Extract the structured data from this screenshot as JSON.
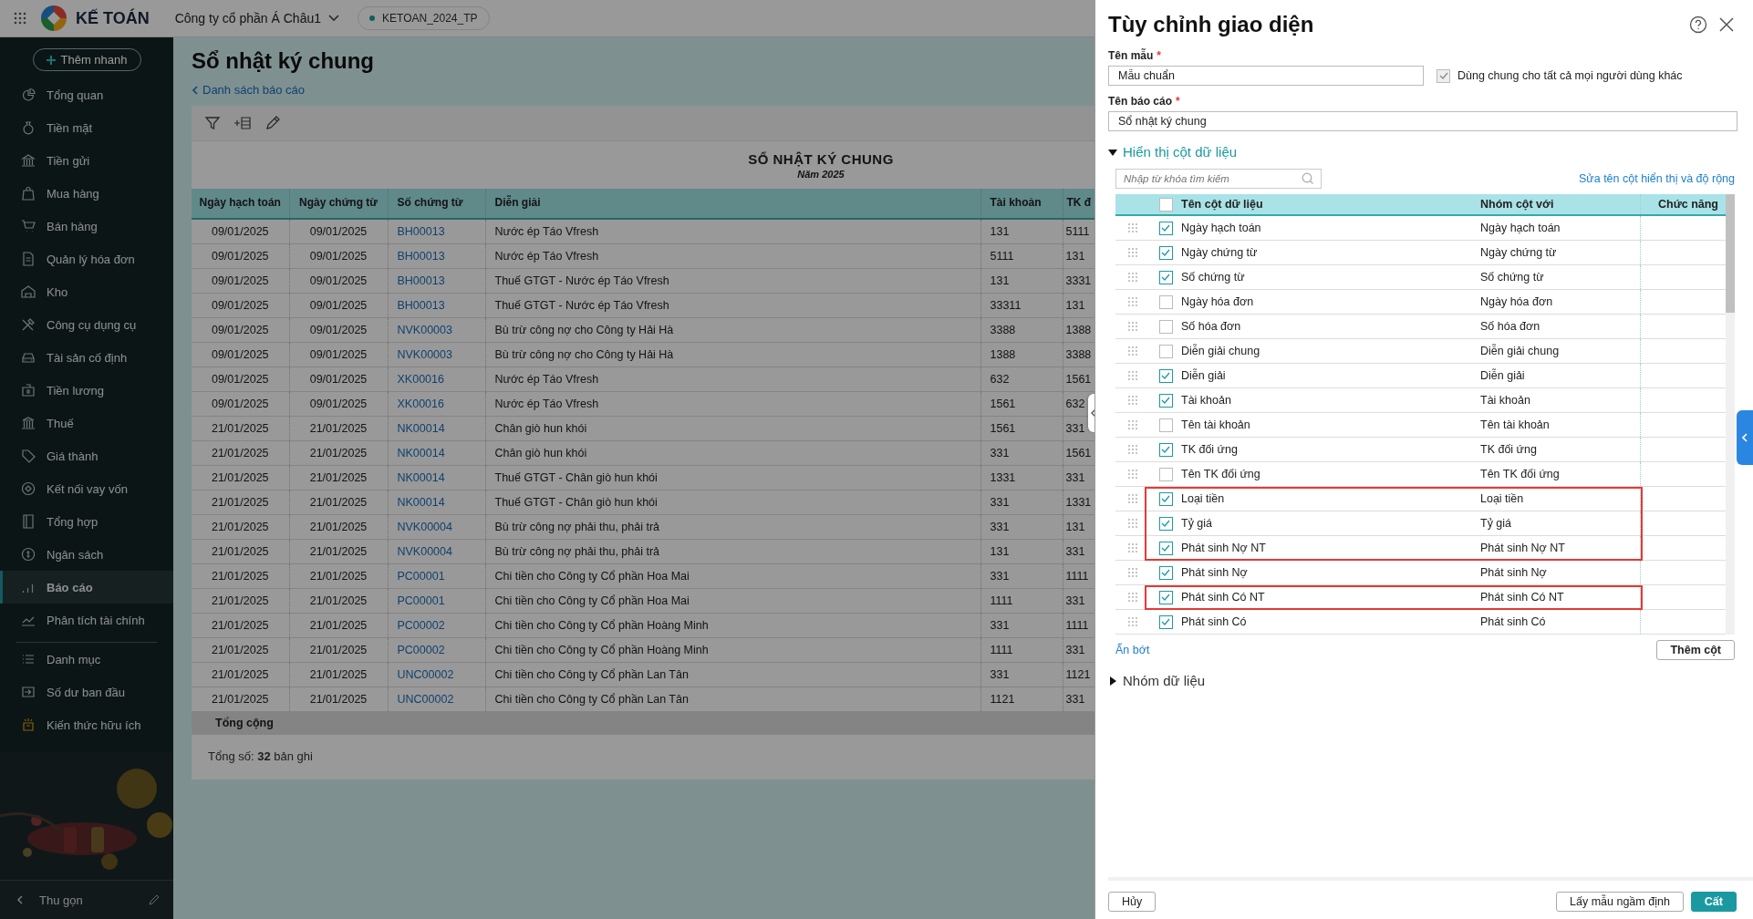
{
  "top_bar": {
    "app_name": "KẾ TOÁN",
    "company": "Công ty cổ phần Á Châu1",
    "database": "KETOAN_2024_TP"
  },
  "sidebar": {
    "quick_add": "Thêm nhanh",
    "sections": [
      {
        "items": [
          {
            "label": "Tổng quan",
            "selected": false
          },
          {
            "label": "Tiền mặt",
            "selected": false
          },
          {
            "label": "Tiền gửi",
            "selected": false
          },
          {
            "label": "Mua hàng",
            "selected": false
          },
          {
            "label": "Bán hàng",
            "selected": false
          },
          {
            "label": "Quản lý hóa đơn",
            "selected": false
          },
          {
            "label": "Kho",
            "selected": false
          },
          {
            "label": "Công cụ dụng cụ",
            "selected": false
          },
          {
            "label": "Tài sản cố định",
            "selected": false
          },
          {
            "label": "Tiền lương",
            "selected": false
          },
          {
            "label": "Thuế",
            "selected": false
          },
          {
            "label": "Giá thành",
            "selected": false
          },
          {
            "label": "Kết nối vay vốn",
            "selected": false
          },
          {
            "label": "Tổng hợp",
            "selected": false
          },
          {
            "label": "Ngân sách",
            "selected": false
          },
          {
            "label": "Báo cáo",
            "selected": true
          },
          {
            "label": "Phân tích tài chính",
            "selected": false
          }
        ]
      },
      {
        "items": [
          {
            "label": "Danh mục",
            "selected": false
          },
          {
            "label": "Số dư ban đầu",
            "selected": false
          },
          {
            "label": "Kiến thức hữu ích",
            "selected": false
          }
        ]
      }
    ],
    "collapse": "Thu gọn"
  },
  "page": {
    "title": "Sổ nhật ký chung",
    "back_link": "Danh sách báo cáo",
    "report_title": "SỔ NHẬT KÝ CHUNG",
    "report_subtitle": "Năm 2025",
    "columns": [
      "Ngày hạch toán",
      "Ngày chứng từ",
      "Số chứng từ",
      "Diễn giải",
      "Tài khoản",
      "TK đ"
    ],
    "rows": [
      [
        "09/01/2025",
        "09/01/2025",
        "BH00013",
        "Nước ép Táo Vfresh",
        "131",
        "5111"
      ],
      [
        "09/01/2025",
        "09/01/2025",
        "BH00013",
        "Nước ép Táo Vfresh",
        "5111",
        "131"
      ],
      [
        "09/01/2025",
        "09/01/2025",
        "BH00013",
        "Thuế GTGT - Nước ép Táo Vfresh",
        "131",
        "3331"
      ],
      [
        "09/01/2025",
        "09/01/2025",
        "BH00013",
        "Thuế GTGT - Nước ép Táo Vfresh",
        "33311",
        "131"
      ],
      [
        "09/01/2025",
        "09/01/2025",
        "NVK00003",
        "Bù trừ công nợ cho Công ty Hải Hà",
        "3388",
        "1388"
      ],
      [
        "09/01/2025",
        "09/01/2025",
        "NVK00003",
        "Bù trừ công nợ cho Công ty Hải Hà",
        "1388",
        "3388"
      ],
      [
        "09/01/2025",
        "09/01/2025",
        "XK00016",
        "Nước ép Táo Vfresh",
        "632",
        "1561"
      ],
      [
        "09/01/2025",
        "09/01/2025",
        "XK00016",
        "Nước ép Táo Vfresh",
        "1561",
        "632"
      ],
      [
        "21/01/2025",
        "21/01/2025",
        "NK00014",
        "Chân giò hun khói",
        "1561",
        "331"
      ],
      [
        "21/01/2025",
        "21/01/2025",
        "NK00014",
        "Chân giò hun khói",
        "331",
        "1561"
      ],
      [
        "21/01/2025",
        "21/01/2025",
        "NK00014",
        "Thuế GTGT - Chân giò hun khói",
        "1331",
        "331"
      ],
      [
        "21/01/2025",
        "21/01/2025",
        "NK00014",
        "Thuế GTGT - Chân giò hun khói",
        "331",
        "1331"
      ],
      [
        "21/01/2025",
        "21/01/2025",
        "NVK00004",
        "Bù trừ công nợ phải thu, phải trả",
        "331",
        "131"
      ],
      [
        "21/01/2025",
        "21/01/2025",
        "NVK00004",
        "Bù trừ công nợ phải thu, phải trả",
        "131",
        "331"
      ],
      [
        "21/01/2025",
        "21/01/2025",
        "PC00001",
        "Chi tiền cho Công ty Cổ phần Hoa Mai",
        "331",
        "1111"
      ],
      [
        "21/01/2025",
        "21/01/2025",
        "PC00001",
        "Chi tiền cho Công ty Cổ phần Hoa Mai",
        "1111",
        "331"
      ],
      [
        "21/01/2025",
        "21/01/2025",
        "PC00002",
        "Chi tiền cho Công ty Cổ phần Hoàng Minh",
        "331",
        "1111"
      ],
      [
        "21/01/2025",
        "21/01/2025",
        "PC00002",
        "Chi tiền cho Công ty Cổ phần Hoàng Minh",
        "1111",
        "331"
      ],
      [
        "21/01/2025",
        "21/01/2025",
        "UNC00002",
        "Chi tiền cho Công ty Cổ phần Lan Tân",
        "331",
        "1121"
      ],
      [
        "21/01/2025",
        "21/01/2025",
        "UNC00002",
        "Chi tiền cho Công ty Cổ phần Lan Tân",
        "1121",
        "331"
      ]
    ],
    "footer_label": "Tổng cộng",
    "record_count": "Tổng số: **32** bản ghi"
  },
  "panel": {
    "title": "Tùy chỉnh giao diện",
    "template_field": {
      "label": "Tên mẫu",
      "required_mark": "*",
      "value": "Mẫu chuẩn"
    },
    "share_option": {
      "label": "Dùng chung cho tất cả mọi người dùng khác",
      "checked": true
    },
    "report_field": {
      "label": "Tên báo cáo",
      "required_mark": "*",
      "value": "Sổ nhật ký chung"
    },
    "sections": [
      {
        "title": "Hiển thị cột dữ liệu",
        "expanded": true,
        "search": {
          "placeholder": "Nhập từ khóa tìm kiếm"
        },
        "edit_link": "Sửa tên cột hiển thị và độ rộng",
        "columns": [
          "Tên cột dữ liệu",
          "Nhóm cột với",
          "Chức năng"
        ],
        "all_checked": false,
        "rows": [
          {
            "name": "Ngày hạch toán",
            "group": "Ngày hạch toán",
            "checked": true,
            "highlighted": false
          },
          {
            "name": "Ngày chứng từ",
            "group": "Ngày chứng từ",
            "checked": true,
            "highlighted": false
          },
          {
            "name": "Số chứng từ",
            "group": "Số chứng từ",
            "checked": true,
            "highlighted": false
          },
          {
            "name": "Ngày hóa đơn",
            "group": "Ngày hóa đơn",
            "checked": false,
            "highlighted": false
          },
          {
            "name": "Số hóa đơn",
            "group": "Số hóa đơn",
            "checked": false,
            "highlighted": false
          },
          {
            "name": "Diễn giải chung",
            "group": "Diễn giải chung",
            "checked": false,
            "highlighted": false
          },
          {
            "name": "Diễn giải",
            "group": "Diễn giải",
            "checked": true,
            "highlighted": false
          },
          {
            "name": "Tài khoản",
            "group": "Tài khoản",
            "checked": true,
            "highlighted": false
          },
          {
            "name": "Tên tài khoản",
            "group": "Tên tài khoản",
            "checked": false,
            "highlighted": false
          },
          {
            "name": "TK đối ứng",
            "group": "TK đối ứng",
            "checked": true,
            "highlighted": false
          },
          {
            "name": "Tên TK đối ứng",
            "group": "Tên TK đối ứng",
            "checked": false,
            "highlighted": false
          },
          {
            "name": "Loại tiền",
            "group": "Loại tiền",
            "checked": true,
            "highlighted": true
          },
          {
            "name": "Tỷ giá",
            "group": "Tỷ giá",
            "checked": true,
            "highlighted": true
          },
          {
            "name": "Phát sinh Nợ NT",
            "group": "Phát sinh Nợ NT",
            "checked": true,
            "highlighted": true
          },
          {
            "name": "Phát sinh Nợ",
            "group": "Phát sinh Nợ",
            "checked": true,
            "highlighted": false
          },
          {
            "name": "Phát sinh Có NT",
            "group": "Phát sinh Có NT",
            "checked": true,
            "highlighted": true
          },
          {
            "name": "Phát sinh Có",
            "group": "Phát sinh Có",
            "checked": true,
            "highlighted": false
          }
        ],
        "less_link": "Ẩn bớt",
        "add_button": "Thêm cột"
      },
      {
        "title": "Nhóm dữ liệu",
        "expanded": false
      }
    ],
    "buttons": {
      "cancel": "Hủy",
      "default": "Lấy mẫu ngầm định",
      "save": "Cất"
    }
  }
}
